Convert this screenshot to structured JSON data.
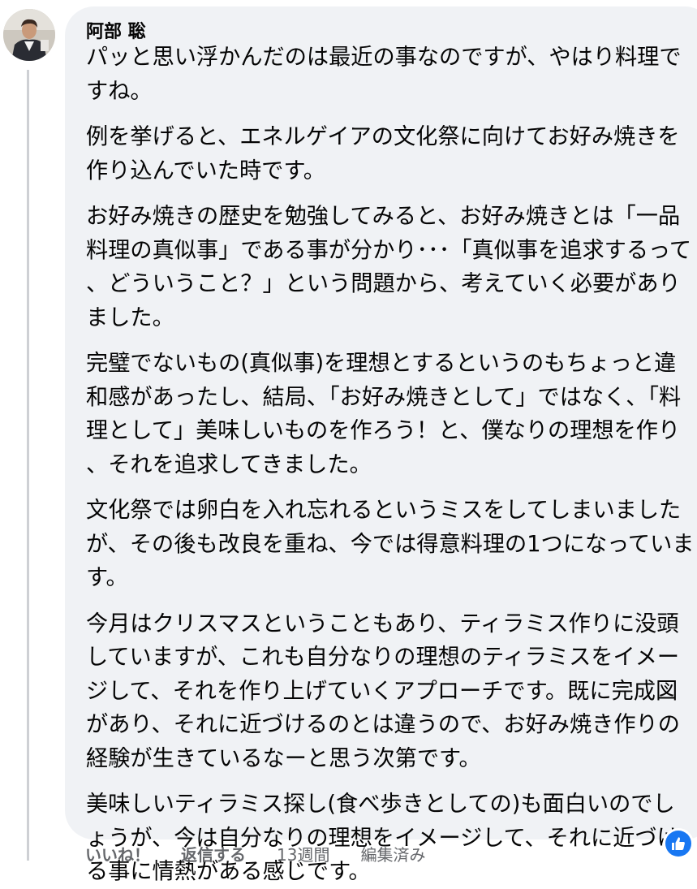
{
  "comment": {
    "author": "阿部 聡",
    "paragraphs": [
      "パッと思い浮かんだのは最近の事なのですが、やはり料理ですね。",
      "例を挙げると、エネルゲイアの文化祭に向けてお好み焼きを作り込んでいた時です。",
      "お好み焼きの歴史を勉強してみると、お好み焼きとは「一品料理の真似事」である事が分かり･･･「真似事を追求するって、どういうこと？」という問題から、考えていく必要がありました。",
      "完璧でないもの(真似事)を理想とするというのもちょっと違和感があったし、結局、「お好み焼きとして」ではなく、「料理として」美味しいものを作ろう！と、僕なりの理想を作り、それを追求してきました。",
      "文化祭では卵白を入れ忘れるというミスをしてしまいましたが、その後も改良を重ね、今では得意料理の1つになっています。",
      "今月はクリスマスということもあり、ティラミス作りに没頭していますが、これも自分なりの理想のティラミスをイメージして、それを作り上げていくアプローチです。既に完成図があり、それに近づけるのとは違うので、お好み焼き作りの経験が生きているなーと思う次第です。",
      "美味しいティラミス探し(食べ歩きとしての)も面白いのでしょうが、今は自分なりの理想をイメージして、それに近づける事に情熱がある感じです。"
    ]
  },
  "actions": {
    "like_label": "いいね！",
    "reply_label": "返信する",
    "time": "13週間",
    "edited": "編集済み"
  },
  "reaction": {
    "icon": "thumbs-up-icon",
    "color": "#1877f2"
  },
  "colors": {
    "bubble_bg": "#f0f2f5",
    "text": "#050505",
    "secondary": "#65676b"
  }
}
